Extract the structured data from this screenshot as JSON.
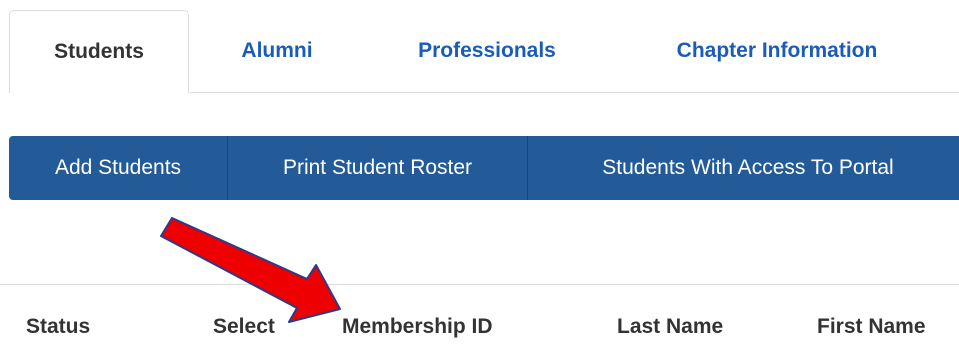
{
  "tabs": [
    {
      "label": "Students",
      "active": true
    },
    {
      "label": "Alumni",
      "active": false
    },
    {
      "label": "Professionals",
      "active": false
    },
    {
      "label": "Chapter Information",
      "active": false
    }
  ],
  "toolbar": {
    "add_students_label": "Add Students",
    "print_roster_label": "Print Student Roster",
    "portal_access_label": "Students With Access To Portal"
  },
  "table": {
    "columns": [
      "Status",
      "Select",
      "Membership ID",
      "Last Name",
      "First Name"
    ]
  },
  "annotation": {
    "arrow_color": "#ee0000",
    "arrow_outline_color": "#2b3a8c",
    "points_to": "Membership ID"
  },
  "colors": {
    "tab_link": "#1a5cb8",
    "button_bg": "#225b97",
    "header_text": "#333333"
  }
}
